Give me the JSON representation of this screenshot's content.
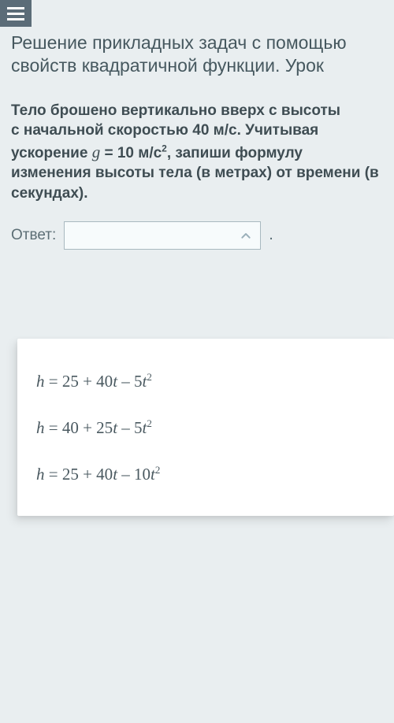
{
  "header": {
    "title": "Решение прикладных задач с помощью свойств квадратичной функции. Урок"
  },
  "problem": {
    "line1": "Тело брошено вертикально вверх с высоты",
    "line2": "с начальной скоростью 40 м/с. Учитывая",
    "line3_a": "ускорение ",
    "line3_g": "g",
    "line3_b": " = 10 м/с",
    "line3_sup": "2",
    "line3_c": ", запиши формулу",
    "line4": "изменения высоты тела (в метрах) от времени (в",
    "line5": "секундах)."
  },
  "answer": {
    "label": "Ответ:",
    "selected": "",
    "period": "."
  },
  "options": [
    {
      "h": "h",
      "eq": " = 25 + 40",
      "t1": "t",
      "mid": " – 5",
      "t2": "t",
      "sup": "2"
    },
    {
      "h": "h",
      "eq": " = 40 + 25",
      "t1": "t",
      "mid": " – 5",
      "t2": "t",
      "sup": "2"
    },
    {
      "h": "h",
      "eq": " = 25 + 40",
      "t1": "t",
      "mid": " – 10",
      "t2": "t",
      "sup": "2"
    }
  ]
}
